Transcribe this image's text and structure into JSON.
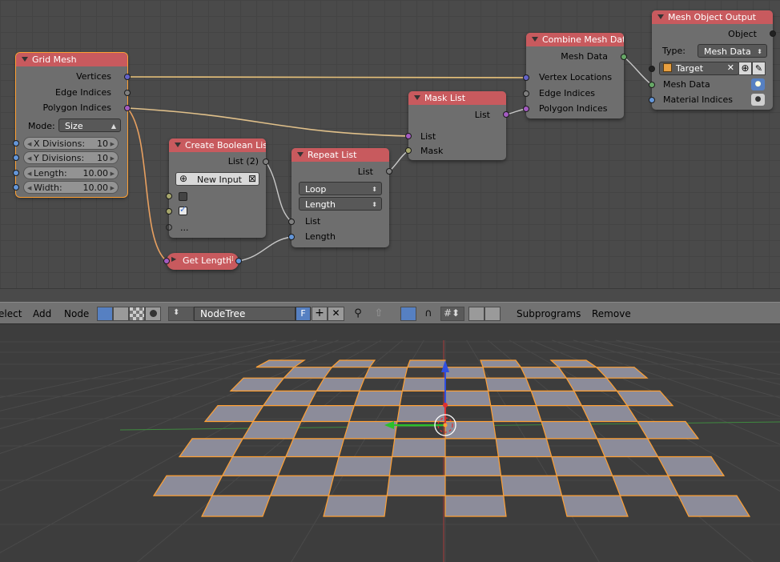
{
  "nodes": {
    "grid_mesh": {
      "title": "Grid Mesh",
      "outputs": [
        "Vertices",
        "Edge Indices",
        "Polygon Indices"
      ],
      "mode_label": "Mode:",
      "mode_value": "Size",
      "x_divisions_label": "X Divisions:",
      "x_divisions_value": "10",
      "y_divisions_label": "Y Divisions:",
      "y_divisions_value": "10",
      "length_label": "Length:",
      "length_value": "10.00",
      "width_label": "Width:",
      "width_value": "10.00"
    },
    "create_boolean_list": {
      "title": "Create Boolean List",
      "output": "List (2)",
      "new_input": "New Input",
      "more": "..."
    },
    "get_length": {
      "title": "Get Length"
    },
    "repeat_list": {
      "title": "Repeat List",
      "output": "List",
      "type_value": "Loop",
      "amount_value": "Length",
      "input_list": "List",
      "input_length": "Length"
    },
    "mask_list": {
      "title": "Mask List",
      "output": "List",
      "input_list": "List",
      "input_mask": "Mask"
    },
    "combine_mesh_data": {
      "title": "Combine Mesh Data",
      "output": "Mesh Data",
      "inputs": [
        "Vertex Locations",
        "Edge Indices",
        "Polygon Indices"
      ]
    },
    "mesh_object_output": {
      "title": "Mesh Object Output",
      "output": "Object",
      "type_label": "Type:",
      "type_value": "Mesh Data",
      "target": "Target",
      "inputs": [
        "Mesh Data",
        "Material Indices"
      ]
    }
  },
  "header": {
    "menu": [
      "elect",
      "Add",
      "Node"
    ],
    "tree_name": "NodeTree",
    "fake_user": "F",
    "subprograms": "Subprograms",
    "remove": "Remove"
  },
  "colors": {
    "node_header": "#c85a5e",
    "node_body": "#6e6e6e",
    "wire_selected": "#f0b060",
    "mesh_face": "#8c8c9a",
    "mesh_edge": "#ffa033"
  }
}
